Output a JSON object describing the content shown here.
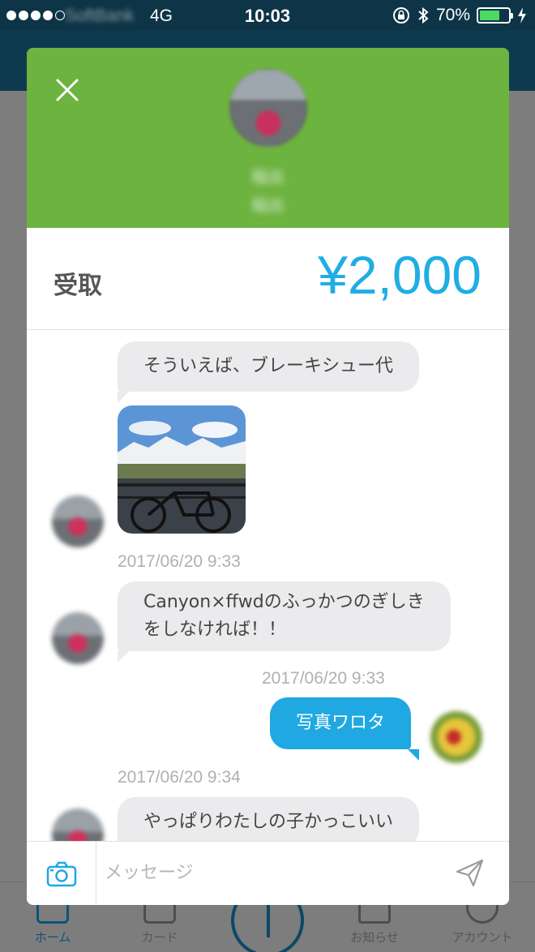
{
  "status_bar": {
    "carrier": "SoftBank",
    "network": "4G",
    "time": "10:03",
    "battery": "70%",
    "battery_level": 0.7
  },
  "background_tabs": [
    {
      "label": "ホーム"
    },
    {
      "label": "カード"
    },
    {
      "label": "お知らせ"
    },
    {
      "label": "アカウント"
    }
  ],
  "modal": {
    "header_color": "#6db33f",
    "sender_name_line1": "稲出",
    "sender_name_line2": "稲出",
    "amount_label": "受取",
    "amount_value": "¥2,000",
    "amount_color": "#1faee3"
  },
  "messages": {
    "m1_text": "そういえば、ブレーキシュー代",
    "m1_time": "2017/06/20 9:33",
    "m2_line1": "Canyon×ffwdのふっかつのぎしき",
    "m2_line2": "をしなければ！！",
    "m2_time": "2017/06/20 9:33",
    "m3_text": "写真ワロタ",
    "m3_time": "2017/06/20 9:34",
    "m4_text": "やっぱりわたしの子かっこいい"
  },
  "input": {
    "placeholder": "メッセージ"
  }
}
